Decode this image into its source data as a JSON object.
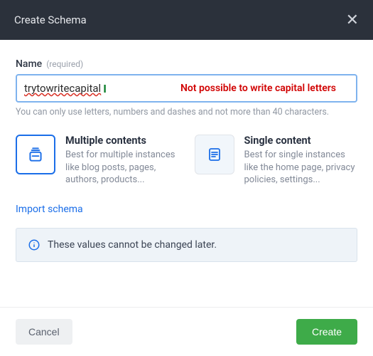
{
  "header": {
    "title": "Create Schema"
  },
  "name_field": {
    "label": "Name",
    "required_hint": "(required)",
    "value": "trytowritecapital",
    "annotation": "Not possible to write capital letters",
    "hint": "You can only use letters, numbers and dashes and not more than 40 characters."
  },
  "options": [
    {
      "title": "Multiple contents",
      "desc": "Best for multiple instances like blog posts, pages, authors, products...",
      "selected": true,
      "icon": "stack-icon"
    },
    {
      "title": "Single content",
      "desc": "Best for single instances like the home page, privacy policies, settings...",
      "selected": false,
      "icon": "page-icon"
    }
  ],
  "import_link": "Import schema",
  "alert": "These values cannot be changed later.",
  "footer": {
    "cancel": "Cancel",
    "create": "Create"
  }
}
